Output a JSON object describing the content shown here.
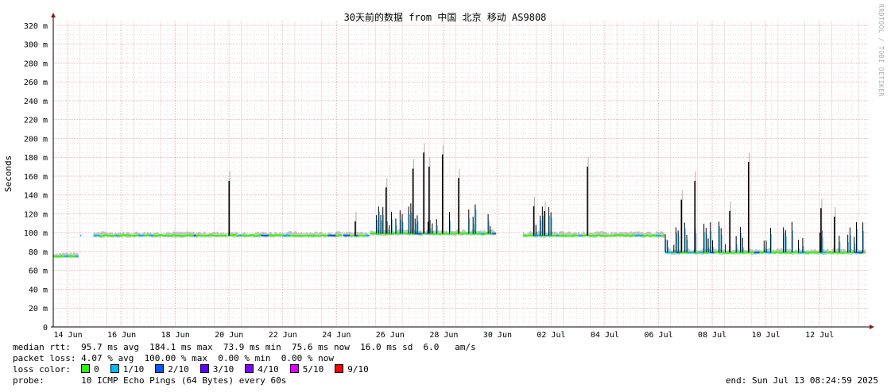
{
  "chart_data": {
    "type": "line",
    "title": "30天前的数据 from 中国 北京 移动 AS9808",
    "ylabel": "Seconds",
    "xlabel": "",
    "ylim": [
      0,
      325
    ],
    "y_ticks": [
      0,
      20,
      40,
      60,
      80,
      100,
      120,
      140,
      160,
      180,
      200,
      220,
      240,
      260,
      280,
      300,
      320
    ],
    "y_tick_labels": [
      "0",
      "20 m",
      "40 m",
      "60 m",
      "80 m",
      "100 m",
      "120 m",
      "140 m",
      "160 m",
      "180 m",
      "200 m",
      "220 m",
      "240 m",
      "260 m",
      "280 m",
      "300 m",
      "320 m"
    ],
    "x_ticks": [
      {
        "day": 0.55,
        "label": "14 Jun"
      },
      {
        "day": 2.55,
        "label": "16 Jun"
      },
      {
        "day": 4.55,
        "label": "18 Jun"
      },
      {
        "day": 6.55,
        "label": "20 Jun"
      },
      {
        "day": 8.55,
        "label": "22 Jun"
      },
      {
        "day": 10.55,
        "label": "24 Jun"
      },
      {
        "day": 12.55,
        "label": "26 Jun"
      },
      {
        "day": 14.55,
        "label": "28 Jun"
      },
      {
        "day": 16.55,
        "label": "30 Jun"
      },
      {
        "day": 18.55,
        "label": "02 Jul"
      },
      {
        "day": 20.55,
        "label": "04 Jul"
      },
      {
        "day": 22.55,
        "label": "06 Jul"
      },
      {
        "day": 24.55,
        "label": "08 Jul"
      },
      {
        "day": 26.55,
        "label": "10 Jul"
      },
      {
        "day": 28.55,
        "label": "12 Jul"
      }
    ],
    "x_range_days": [
      0,
      30.35
    ],
    "grid": true,
    "series": [
      {
        "segments": [
          {
            "x": [
              0.0,
              1.0
            ],
            "median": [
              75,
              75
            ]
          },
          {
            "x": [
              1.0,
              1.05
            ],
            "median": [
              97,
              97
            ]
          },
          {
            "x": [
              1.5,
              6.5
            ],
            "median": [
              97,
              97
            ]
          },
          {
            "x": [
              6.5,
              10.8
            ],
            "median": [
              97,
              97
            ]
          },
          {
            "x": [
              10.8,
              11.8
            ],
            "median": [
              97,
              97
            ]
          },
          {
            "x": [
              11.8,
              16.5
            ],
            "median": [
              99,
              99
            ]
          },
          {
            "x": [
              17.5,
              22.8
            ],
            "median": [
              97,
              97
            ]
          },
          {
            "x": [
              22.8,
              30.3
            ],
            "median": [
              79,
              79
            ]
          }
        ],
        "spikes": [
          {
            "x": 6.55,
            "y": 155
          },
          {
            "x": 11.25,
            "y": 112
          },
          {
            "x": 12.4,
            "y": 148
          },
          {
            "x": 13.4,
            "y": 168
          },
          {
            "x": 13.8,
            "y": 185
          },
          {
            "x": 14.0,
            "y": 170
          },
          {
            "x": 14.5,
            "y": 183
          },
          {
            "x": 15.1,
            "y": 158
          },
          {
            "x": 17.9,
            "y": 128
          },
          {
            "x": 18.3,
            "y": 123
          },
          {
            "x": 19.9,
            "y": 170
          },
          {
            "x": 23.4,
            "y": 135
          },
          {
            "x": 23.9,
            "y": 155
          },
          {
            "x": 25.2,
            "y": 123
          },
          {
            "x": 25.9,
            "y": 175
          },
          {
            "x": 28.6,
            "y": 126
          },
          {
            "x": 29.1,
            "y": 117
          }
        ]
      }
    ]
  },
  "colors": {
    "median_line": "#000000",
    "smoke": "#9a9a9a",
    "loss_0": "#26ff00",
    "loss_1": "#00b8ff",
    "loss_2": "#0059ff",
    "loss_3": "#5e00ff",
    "loss_4": "#7e00ff",
    "loss_5": "#dd00ff",
    "loss_9": "#ff0000",
    "grid_major": "#e8a0a0",
    "axis_arrow": "#8b1a1a"
  },
  "stats": {
    "median_rtt": "median rtt:  95.7 ms avg  184.1 ms max  73.9 ms min  75.6 ms now  16.0 ms sd  6.0   am/s",
    "packet_loss": "packet loss: 4.07 % avg  100.00 % max  0.00 % min  0.00 % now",
    "loss_color_label": "loss color:",
    "loss_items": [
      {
        "label": "0",
        "color": "#26ff00"
      },
      {
        "label": "1/10",
        "color": "#00b8ff"
      },
      {
        "label": "2/10",
        "color": "#0059ff"
      },
      {
        "label": "3/10",
        "color": "#5e00ff"
      },
      {
        "label": "4/10",
        "color": "#7e00ff"
      },
      {
        "label": "5/10",
        "color": "#dd00ff"
      },
      {
        "label": "9/10",
        "color": "#ff0000"
      }
    ],
    "probe": "probe:       10 ICMP Echo Pings (64 Bytes) every 60s",
    "end": "end: Sun Jul 13 08:24:59 2025"
  },
  "watermark": "RRDTOOL / TOBI OETIKER"
}
